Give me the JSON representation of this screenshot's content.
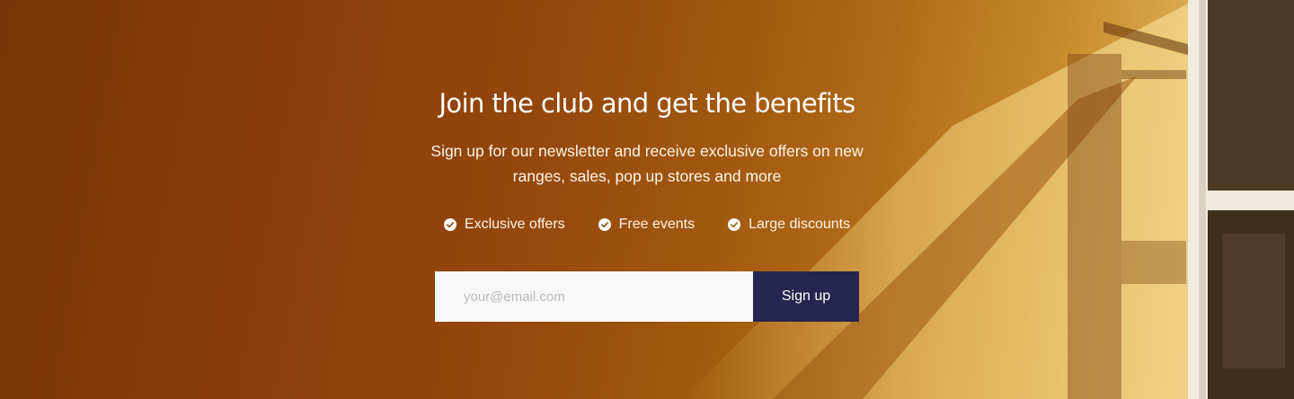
{
  "newsletter": {
    "headline": "Join the club and get the benefits",
    "subtext": "Sign up for our newsletter and receive exclusive offers on new ranges, sales, pop up stores and more",
    "benefits": [
      {
        "label": "Exclusive offers",
        "icon": "check-circle-icon"
      },
      {
        "label": "Free events",
        "icon": "check-circle-icon"
      },
      {
        "label": "Large discounts",
        "icon": "check-circle-icon"
      }
    ],
    "email_placeholder": "your@email.com",
    "email_value": "",
    "signup_label": "Sign up"
  },
  "colors": {
    "button_bg": "#26254f",
    "input_bg": "#f8f8f8",
    "text_light": "#ffffff"
  }
}
